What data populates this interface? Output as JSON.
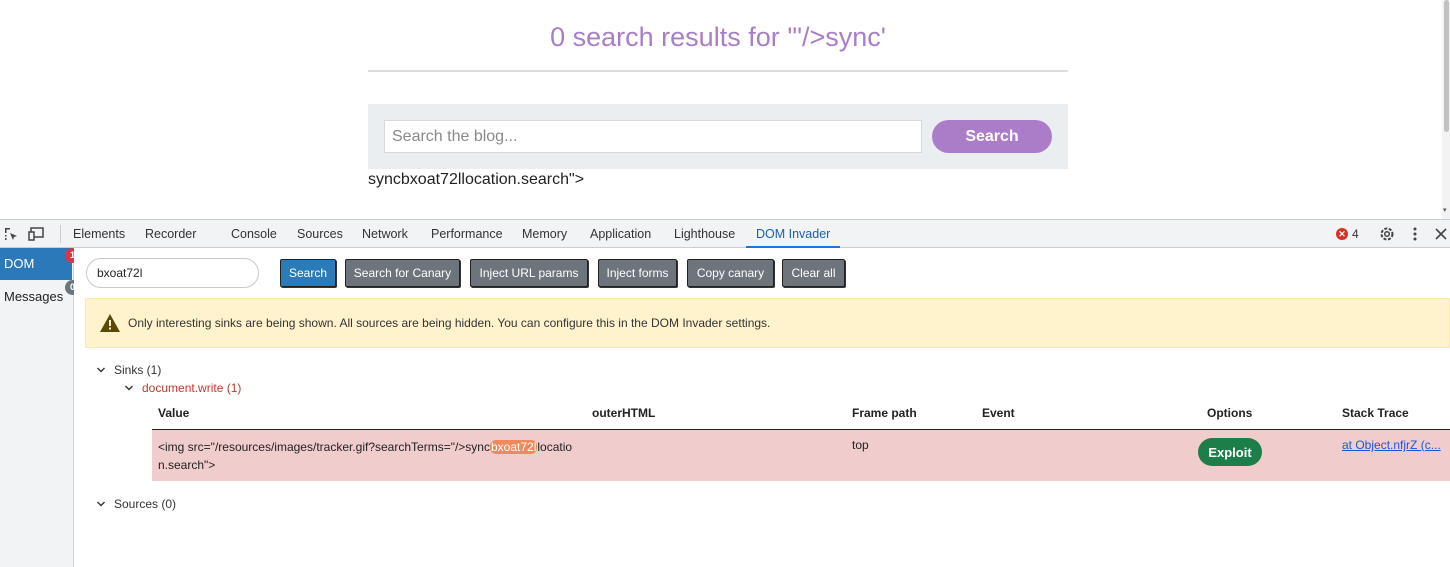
{
  "page": {
    "results_title": "0 search results for '\"/>sync'",
    "search_placeholder": "Search the blog...",
    "search_button": "Search",
    "echo_text": "syncbxoat72llocation.search\">"
  },
  "devtools": {
    "tabs": [
      "Elements",
      "Recorder",
      "Console",
      "Sources",
      "Network",
      "Performance",
      "Memory",
      "Application",
      "Lighthouse",
      "DOM Invader"
    ],
    "active_tab": "DOM Invader",
    "error_count": "4",
    "error_icon_glyph": "✕"
  },
  "dom_invader": {
    "nav": {
      "dom_label": "DOM",
      "dom_badge": "1",
      "messages_label": "Messages",
      "messages_badge": "0"
    },
    "canary_value": "bxoat72l",
    "buttons": {
      "search": "Search",
      "search_canary": "Search for Canary",
      "inject_url": "Inject URL params",
      "inject_forms": "Inject forms",
      "copy_canary": "Copy canary",
      "clear_all": "Clear all"
    },
    "warning_text": "Only interesting sinks are being shown. All sources are being hidden. You can configure this in the DOM Invader settings.",
    "sinks_label": "Sinks (1)",
    "sink_name": "document.write (1)",
    "sources_label": "Sources (0)",
    "table": {
      "headers": {
        "value": "Value",
        "outer_html": "outerHTML",
        "frame_path": "Frame path",
        "event": "Event",
        "options": "Options",
        "stack_trace": "Stack Trace"
      },
      "row": {
        "value_before": "<img src=\"/resources/images/tracker.gif?searchTerms=\"/>sync",
        "value_highlight": "bxoat72l",
        "value_after_line1": "locatio",
        "value_line2": "n.search\">",
        "frame_path": "top",
        "option_button": "Exploit",
        "stack_trace": "at Object.nfjrZ (c..."
      }
    }
  },
  "colors": {
    "title_purple": "#a97ec9",
    "accent_blue": "#2b7bb9",
    "sink_row_bg": "#f0cccd",
    "highlight_orange": "#f08a5a",
    "exploit_green": "#1e7e4a",
    "warning_bg": "#fff3cd"
  }
}
